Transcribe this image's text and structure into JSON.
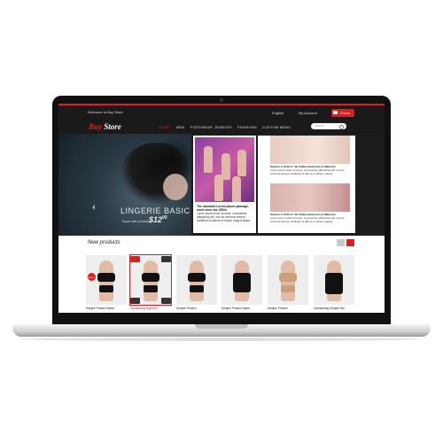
{
  "store": {
    "welcome": "Welcome to Buy Store",
    "logo_a": "Buy",
    "logo_b": "Store",
    "top_links": {
      "language": "English",
      "account": "My Account"
    },
    "cart_label": "0 item"
  },
  "nav": {
    "items": [
      {
        "label": "HOME",
        "active": true
      },
      {
        "label": "MEN",
        "active": false
      },
      {
        "label": "FOOTWEAR",
        "active": false
      },
      {
        "label": "JEWELRY",
        "active": false
      },
      {
        "label": "FASHIONS",
        "active": false
      },
      {
        "label": "CUSTOM MENU",
        "active": false
      }
    ],
    "search_placeholder": "Search"
  },
  "hero": {
    "title": "LINGERIE BASIC B",
    "subtitle": "Super sale products",
    "price": "$12",
    "price_cents": "00"
  },
  "feature": {
    "heading": "The standard Lorem Ipsum passage, used since the 1500s",
    "body": "Lorem ipsum dolor sit amet, consectetur adipisicing elit, sed do eiusmod tempor incididunt ut labore et dolore magna aliqua."
  },
  "side": [
    {
      "heading": "Section 1.10.33 of \"de Finibus Bonorum et Malorum",
      "body": "Lorem ipsum dolor sit amet, consectetur adipisicing elit, sed do eiusmod tempor incididunt ut labore et dolore magna"
    },
    {
      "heading": "Section 1.10.33 of \"de Finibus Bonorum et Malorum",
      "body": "Lorem ipsum dolor sit amet, consectetur adipisicing elit, sed do eiusmod tempor incididunt ut labore et dolore magna"
    }
  ],
  "new_products": {
    "title": "New products",
    "items": [
      {
        "name": "Sample Product Name",
        "badge": "New",
        "selected": false
      },
      {
        "name": "Outstanding lingerie R",
        "badge": "",
        "selected": true
      },
      {
        "name": "Sample Product",
        "badge": "",
        "selected": false
      },
      {
        "name": "Sample Product Name",
        "badge": "",
        "selected": false
      },
      {
        "name": "Sample Product",
        "badge": "",
        "selected": false
      },
      {
        "name": "Outstanding Sample Set",
        "badge": "",
        "selected": false
      }
    ]
  },
  "colors": {
    "accent": "#e31d1d",
    "dark": "#1a1a1a"
  }
}
